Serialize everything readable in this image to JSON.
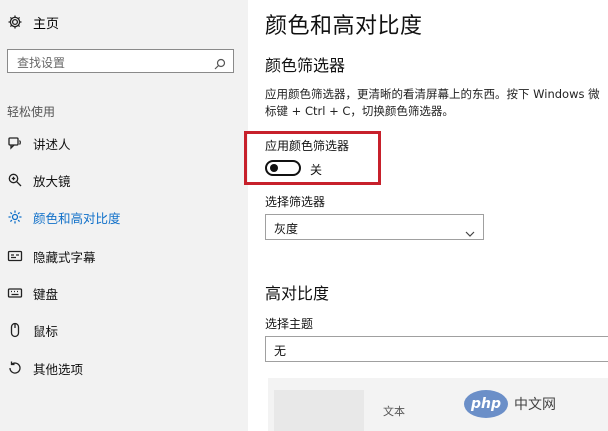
{
  "sidebar": {
    "home_label": "主页",
    "search_placeholder": "查找设置",
    "section_label": "轻松使用",
    "items": [
      {
        "label": "讲述人",
        "icon": "narrator-icon",
        "active": false
      },
      {
        "label": "放大镜",
        "icon": "magnifier-icon",
        "active": false
      },
      {
        "label": "颜色和高对比度",
        "icon": "color-contrast-icon",
        "active": true
      },
      {
        "label": "隐藏式字幕",
        "icon": "closed-caption-icon",
        "active": false
      },
      {
        "label": "键盘",
        "icon": "keyboard-icon",
        "active": false
      },
      {
        "label": "鼠标",
        "icon": "mouse-icon",
        "active": false
      },
      {
        "label": "其他选项",
        "icon": "other-options-icon",
        "active": false
      }
    ]
  },
  "main": {
    "title": "颜色和高对比度",
    "color_filter": {
      "heading": "颜色筛选器",
      "description": "应用颜色筛选器，更清晰的看清屏幕上的东西。按下 Windows 微标键 + Ctrl + C，切换颜色筛选器。",
      "toggle_label": "应用颜色筛选器",
      "toggle_state": "关",
      "toggle_on": false,
      "select_label": "选择筛选器",
      "select_value": "灰度"
    },
    "high_contrast": {
      "heading": "高对比度",
      "theme_label": "选择主题",
      "theme_value": "无",
      "preview_text": "文本"
    }
  },
  "watermark": {
    "logo": "php",
    "text": "中文网"
  },
  "colors": {
    "accent": "#1070c9",
    "highlight_box": "#c7202b",
    "sidebar_bg": "#f2f2f2"
  }
}
